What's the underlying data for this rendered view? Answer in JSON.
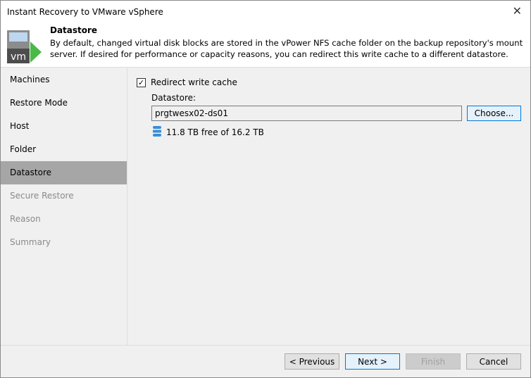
{
  "window": {
    "title": "Instant Recovery to VMware vSphere",
    "close": "✕"
  },
  "header": {
    "title": "Datastore",
    "description": "By default, changed virtual disk blocks are stored in the vPower NFS cache folder on the backup repository's mount server. If desired for performance or capacity reasons, you can redirect this write cache to a different datastore.",
    "logo_text": "vm"
  },
  "sidebar": {
    "items": [
      {
        "label": "Machines"
      },
      {
        "label": "Restore Mode"
      },
      {
        "label": "Host"
      },
      {
        "label": "Folder"
      },
      {
        "label": "Datastore"
      },
      {
        "label": "Secure Restore"
      },
      {
        "label": "Reason"
      },
      {
        "label": "Summary"
      }
    ]
  },
  "main": {
    "redirect_label": "Redirect write cache",
    "redirect_checked": true,
    "datastore_label": "Datastore:",
    "datastore_value": "prgtwesx02-ds01",
    "choose_label": "Choose...",
    "free_text": "11.8 TB free of 16.2 TB"
  },
  "footer": {
    "previous": "< Previous",
    "next": "Next >",
    "finish": "Finish",
    "cancel": "Cancel"
  }
}
